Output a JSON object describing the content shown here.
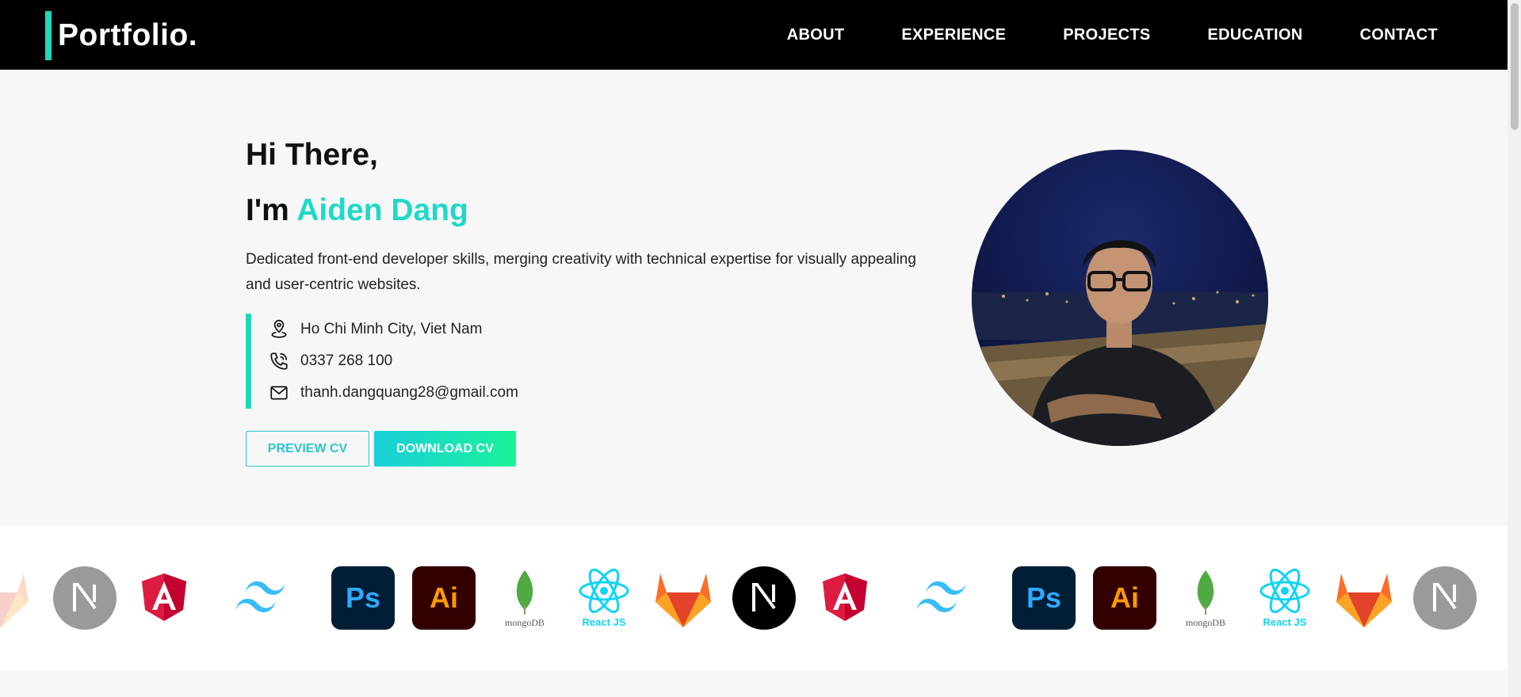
{
  "brand": {
    "name": "Portfolio.",
    "accent": "#1fd8b6"
  },
  "nav": {
    "items": [
      "ABOUT",
      "EXPERIENCE",
      "PROJECTS",
      "EDUCATION",
      "CONTACT"
    ]
  },
  "hero": {
    "greeting": "Hi There,",
    "intro_prefix": "I'm ",
    "name": "Aiden Dang",
    "description": "Dedicated front-end developer skills, merging creativity with technical expertise for visually appealing and user-centric websites.",
    "contacts": [
      {
        "icon": "location-pin-icon",
        "text": "Ho Chi Minh City, Viet Nam"
      },
      {
        "icon": "phone-icon",
        "text": "0337 268 100"
      },
      {
        "icon": "mail-icon",
        "text": "thanh.dangquang28@gmail.com"
      }
    ],
    "buttons": {
      "preview": "PREVIEW CV",
      "download": "DOWNLOAD CV"
    },
    "accent_color": "#1fd8c8"
  },
  "tech_strip": {
    "logos": [
      {
        "name": "nextjs-icon"
      },
      {
        "name": "angular-icon"
      },
      {
        "name": "tailwind-icon"
      },
      {
        "name": "photoshop-icon",
        "label": "Ps"
      },
      {
        "name": "illustrator-icon",
        "label": "Ai"
      },
      {
        "name": "mongodb-icon",
        "label": "mongoDB"
      },
      {
        "name": "react-icon",
        "label": "React JS"
      },
      {
        "name": "gitlab-icon"
      }
    ]
  }
}
